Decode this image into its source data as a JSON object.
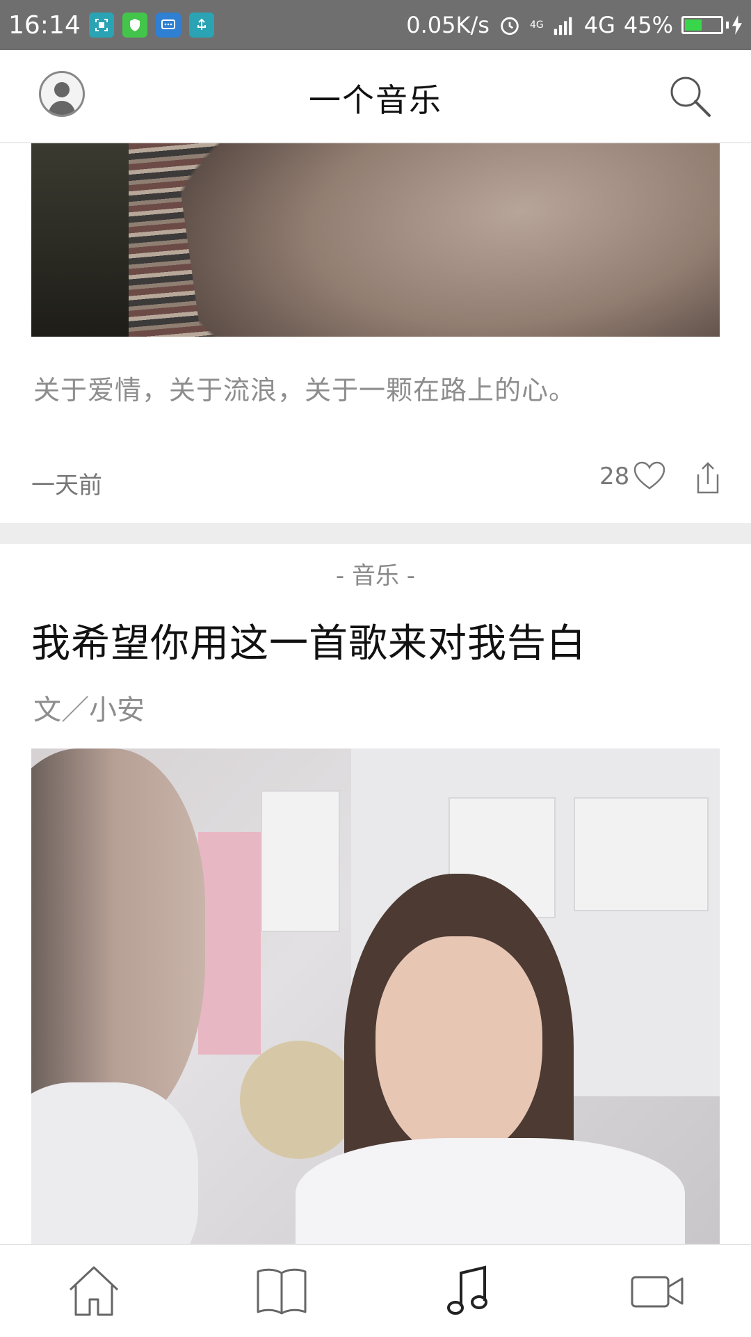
{
  "status_bar": {
    "time": "16:14",
    "network_speed": "0.05K/s",
    "network_type": "4G",
    "network_type_small": "4G",
    "battery_percent": "45%",
    "battery_level": 0.45,
    "icons": [
      "screenshot-icon",
      "shield-icon",
      "message-icon",
      "usb-icon",
      "alarm-icon",
      "signal-icon",
      "battery-icon",
      "charging-icon"
    ]
  },
  "header": {
    "title": "一个音乐",
    "avatar_icon": "user-avatar-icon",
    "search_icon": "search-icon"
  },
  "card1": {
    "description": "关于爱情，关于流浪，关于一颗在路上的心。",
    "time": "一天前",
    "likes": "28"
  },
  "card2": {
    "category": "- 音乐 -",
    "title": "我希望你用这一首歌来对我告白",
    "author": "文／小安"
  },
  "bottom_nav": {
    "items": [
      "home-icon",
      "reading-icon",
      "music-icon",
      "movie-icon"
    ],
    "active": "music-icon"
  },
  "colors": {
    "status_bar_bg": "#6f6f6f",
    "battery_fill": "#39d54a",
    "muted_text": "#8d8d8d",
    "separator": "#ededed"
  }
}
